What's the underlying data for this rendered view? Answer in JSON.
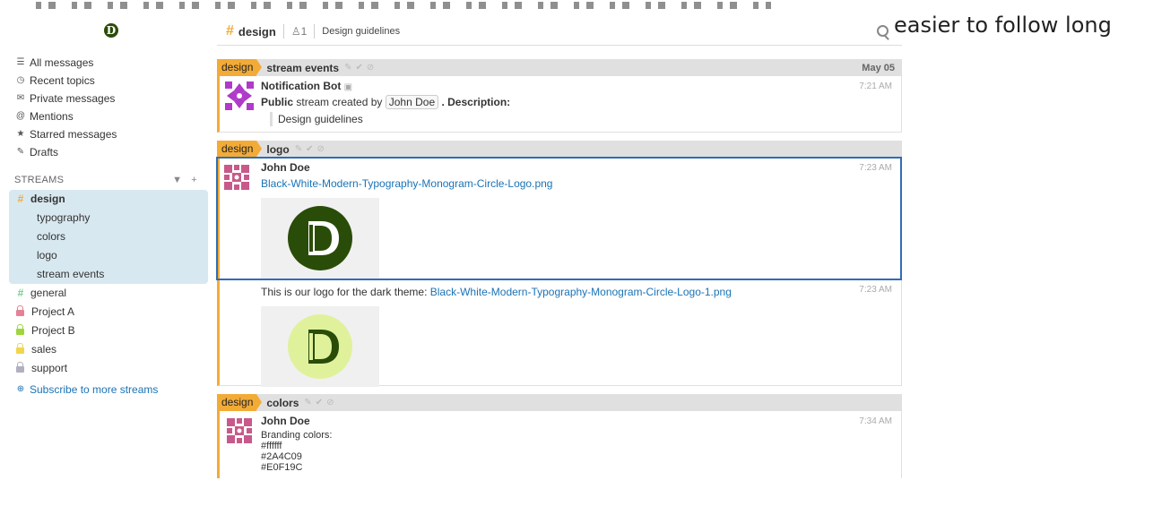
{
  "overlay": {
    "text": "easier to follow long"
  },
  "app": {
    "logo_letter": "D"
  },
  "sidebar": {
    "nav": [
      {
        "label": "All messages",
        "icon": "list-icon"
      },
      {
        "label": "Recent topics",
        "icon": "clock-icon"
      },
      {
        "label": "Private messages",
        "icon": "envelope-icon"
      },
      {
        "label": "Mentions",
        "icon": "at-icon"
      },
      {
        "label": "Starred messages",
        "icon": "star-icon"
      },
      {
        "label": "Drafts",
        "icon": "pencil-icon"
      }
    ],
    "streams_header": "STREAMS",
    "active_stream": {
      "name": "design",
      "color": "#f3ab37"
    },
    "topics": [
      "typography",
      "colors",
      "logo",
      "stream events"
    ],
    "streams": [
      {
        "name": "general",
        "color": "#76ce90",
        "private": false
      },
      {
        "name": "Project A",
        "color": "#e58296",
        "private": true
      },
      {
        "name": "Project B",
        "color": "#9dd73c",
        "private": true
      },
      {
        "name": "sales",
        "color": "#f2d54c",
        "private": true
      },
      {
        "name": "support",
        "color": "#b0b0c0",
        "private": true
      }
    ],
    "subscribe_label": "Subscribe to more streams"
  },
  "header": {
    "stream": "design",
    "subscribers": "1",
    "description": "Design guidelines"
  },
  "feed": {
    "groups": [
      {
        "stream": "design",
        "topic": "stream events",
        "date": "May 05",
        "messages": [
          {
            "sender": "Notification Bot",
            "time": "7:21 AM",
            "public": "Public",
            "text1": "stream created by",
            "mention": "John Doe",
            "text2": ". Description:",
            "quote": "Design guidelines"
          }
        ]
      },
      {
        "stream": "design",
        "topic": "logo",
        "date": "",
        "messages": [
          {
            "sender": "John Doe",
            "time": "7:23 AM",
            "link": "Black-White-Modern-Typography-Monogram-Circle-Logo.png"
          },
          {
            "sender": "",
            "time": "7:23 AM",
            "text": "This is our logo for the dark theme:",
            "link": "Black-White-Modern-Typography-Monogram-Circle-Logo-1.png"
          }
        ]
      },
      {
        "stream": "design",
        "topic": "colors",
        "date": "",
        "messages": [
          {
            "sender": "John Doe",
            "time": "7:34 AM",
            "lines": [
              "Branding colors:",
              "#ffffff",
              "#2A4C09",
              "#E0F19C"
            ]
          }
        ]
      }
    ]
  },
  "colors": {
    "brand_dark": "#2A4C09",
    "brand_light": "#E0F19C",
    "stream_orange": "#f3ab37",
    "selection": "#2f6db5"
  }
}
